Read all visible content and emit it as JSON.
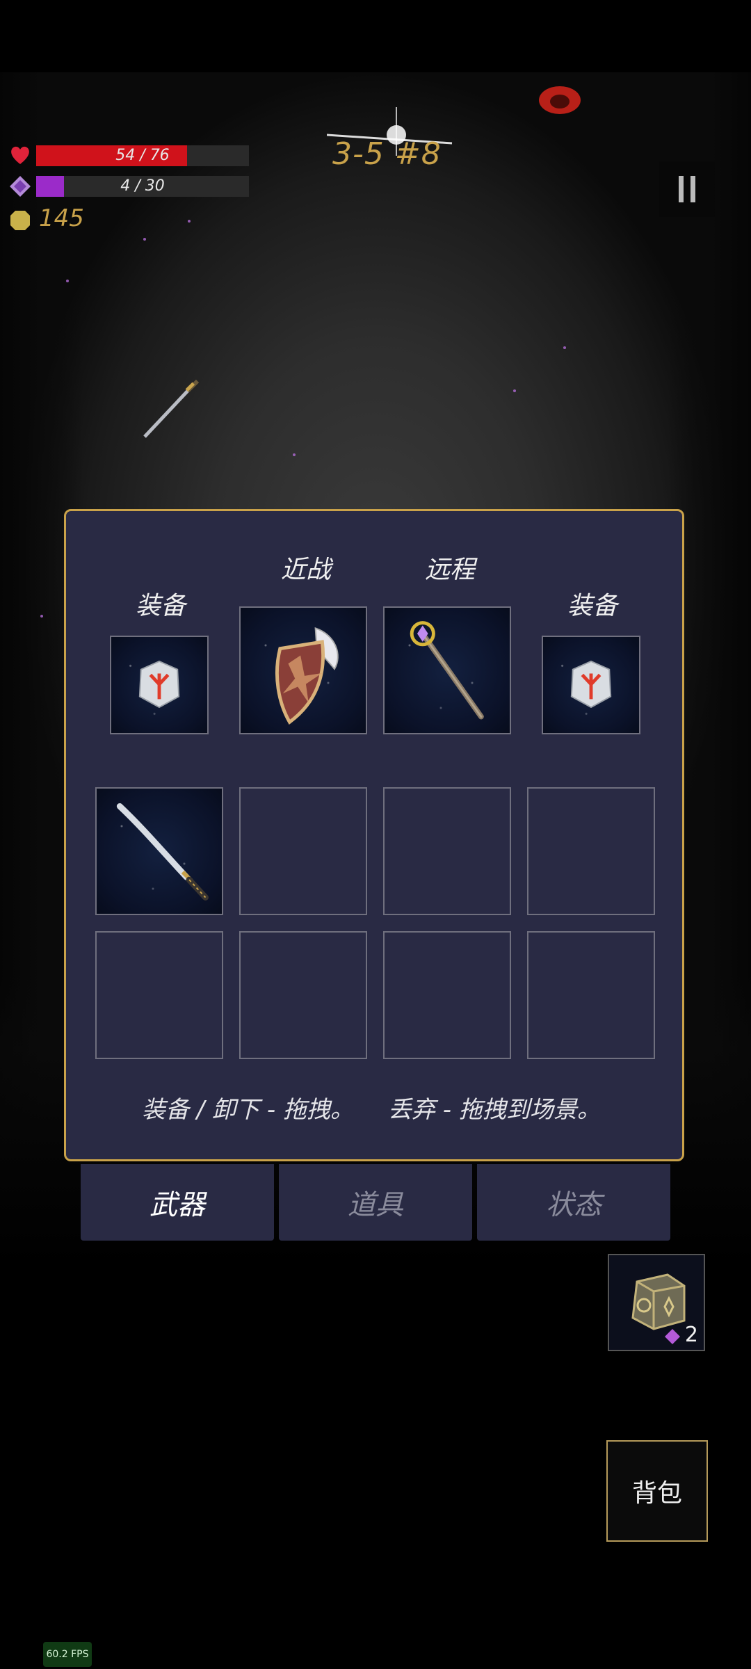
{
  "hud": {
    "hp_text": "54 / 76",
    "hp_fraction": 0.71,
    "hp_color": "#d0121b",
    "mp_text": "4 / 30",
    "mp_fraction": 0.13,
    "mp_color": "#9b2bc9",
    "gold": "145",
    "gold_color": "#c9a24a",
    "level": "3-5 #8"
  },
  "inventory": {
    "labels": {
      "melee": "近战",
      "ranged": "远程",
      "equip_left": "装备",
      "equip_right": "装备"
    },
    "equipped": {
      "left_accessory": "rune-stone-icon",
      "melee": "winged-shield-icon",
      "ranged": "crystal-staff-icon",
      "right_accessory": "rune-stone-icon"
    },
    "bag_slots": [
      "katana-icon",
      "",
      "",
      "",
      "",
      "",
      "",
      ""
    ],
    "hint_equip": "装备 / 卸下 - 拖拽。",
    "hint_discard": "丢弃 - 拖拽到场景。"
  },
  "tabs": [
    {
      "label": "武器",
      "active": true
    },
    {
      "label": "道具",
      "active": false
    },
    {
      "label": "状态",
      "active": false
    }
  ],
  "chest": {
    "count": "2",
    "icon": "rune-chest-icon"
  },
  "bag_button": "背包",
  "fps": "60.2 FPS",
  "colors": {
    "panel_bg": "#292a44",
    "panel_border": "#c9a24a",
    "accent_gold": "#c9a24a"
  }
}
